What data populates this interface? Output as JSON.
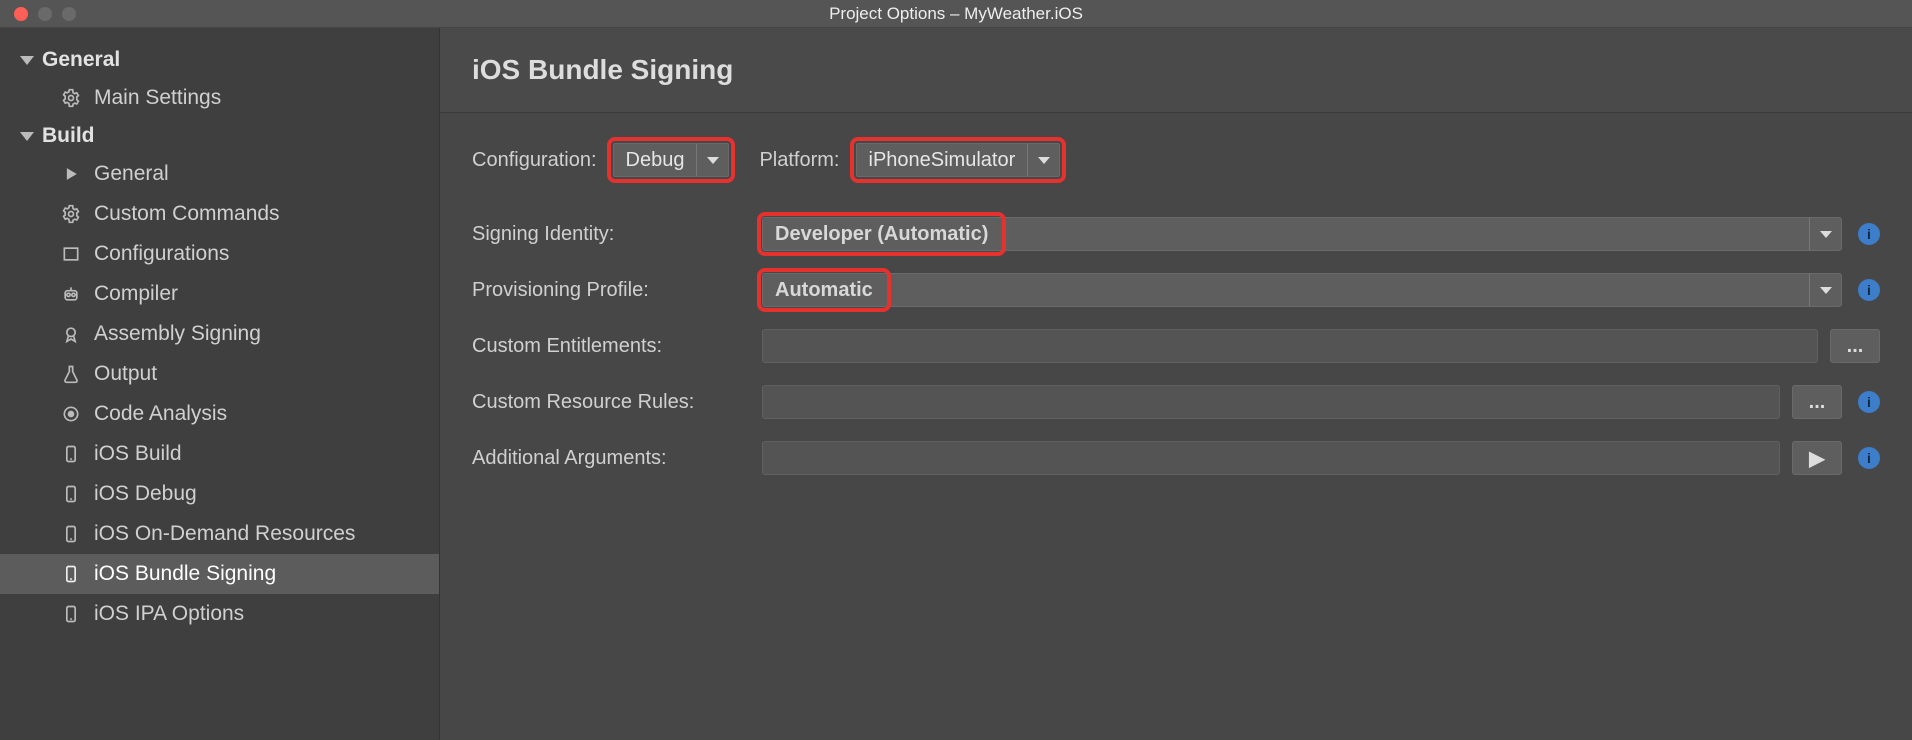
{
  "window": {
    "title": "Project Options – MyWeather.iOS"
  },
  "sidebar": {
    "groups": [
      {
        "label": "General",
        "items": [
          {
            "label": "Main Settings",
            "icon": "gear-icon"
          }
        ]
      },
      {
        "label": "Build",
        "items": [
          {
            "label": "General",
            "icon": "play-icon"
          },
          {
            "label": "Custom Commands",
            "icon": "gear-icon"
          },
          {
            "label": "Configurations",
            "icon": "box-icon"
          },
          {
            "label": "Compiler",
            "icon": "robot-icon"
          },
          {
            "label": "Assembly Signing",
            "icon": "badge-icon"
          },
          {
            "label": "Output",
            "icon": "flask-icon"
          },
          {
            "label": "Code Analysis",
            "icon": "target-icon"
          },
          {
            "label": "iOS Build",
            "icon": "phone-icon"
          },
          {
            "label": "iOS Debug",
            "icon": "phone-icon"
          },
          {
            "label": "iOS On-Demand Resources",
            "icon": "phone-icon"
          },
          {
            "label": "iOS Bundle Signing",
            "icon": "phone-icon",
            "selected": true
          },
          {
            "label": "iOS IPA Options",
            "icon": "phone-icon"
          }
        ]
      }
    ]
  },
  "page": {
    "title": "iOS Bundle Signing",
    "configuration_label": "Configuration:",
    "configuration_value": "Debug",
    "platform_label": "Platform:",
    "platform_value": "iPhoneSimulator",
    "signing_identity_label": "Signing Identity:",
    "signing_identity_value": "Developer (Automatic)",
    "provisioning_profile_label": "Provisioning Profile:",
    "provisioning_profile_value": "Automatic",
    "custom_entitlements_label": "Custom Entitlements:",
    "custom_entitlements_value": "",
    "custom_resource_rules_label": "Custom Resource Rules:",
    "custom_resource_rules_value": "",
    "additional_arguments_label": "Additional Arguments:",
    "additional_arguments_value": "",
    "browse_button": "...",
    "run_button": "▶"
  }
}
